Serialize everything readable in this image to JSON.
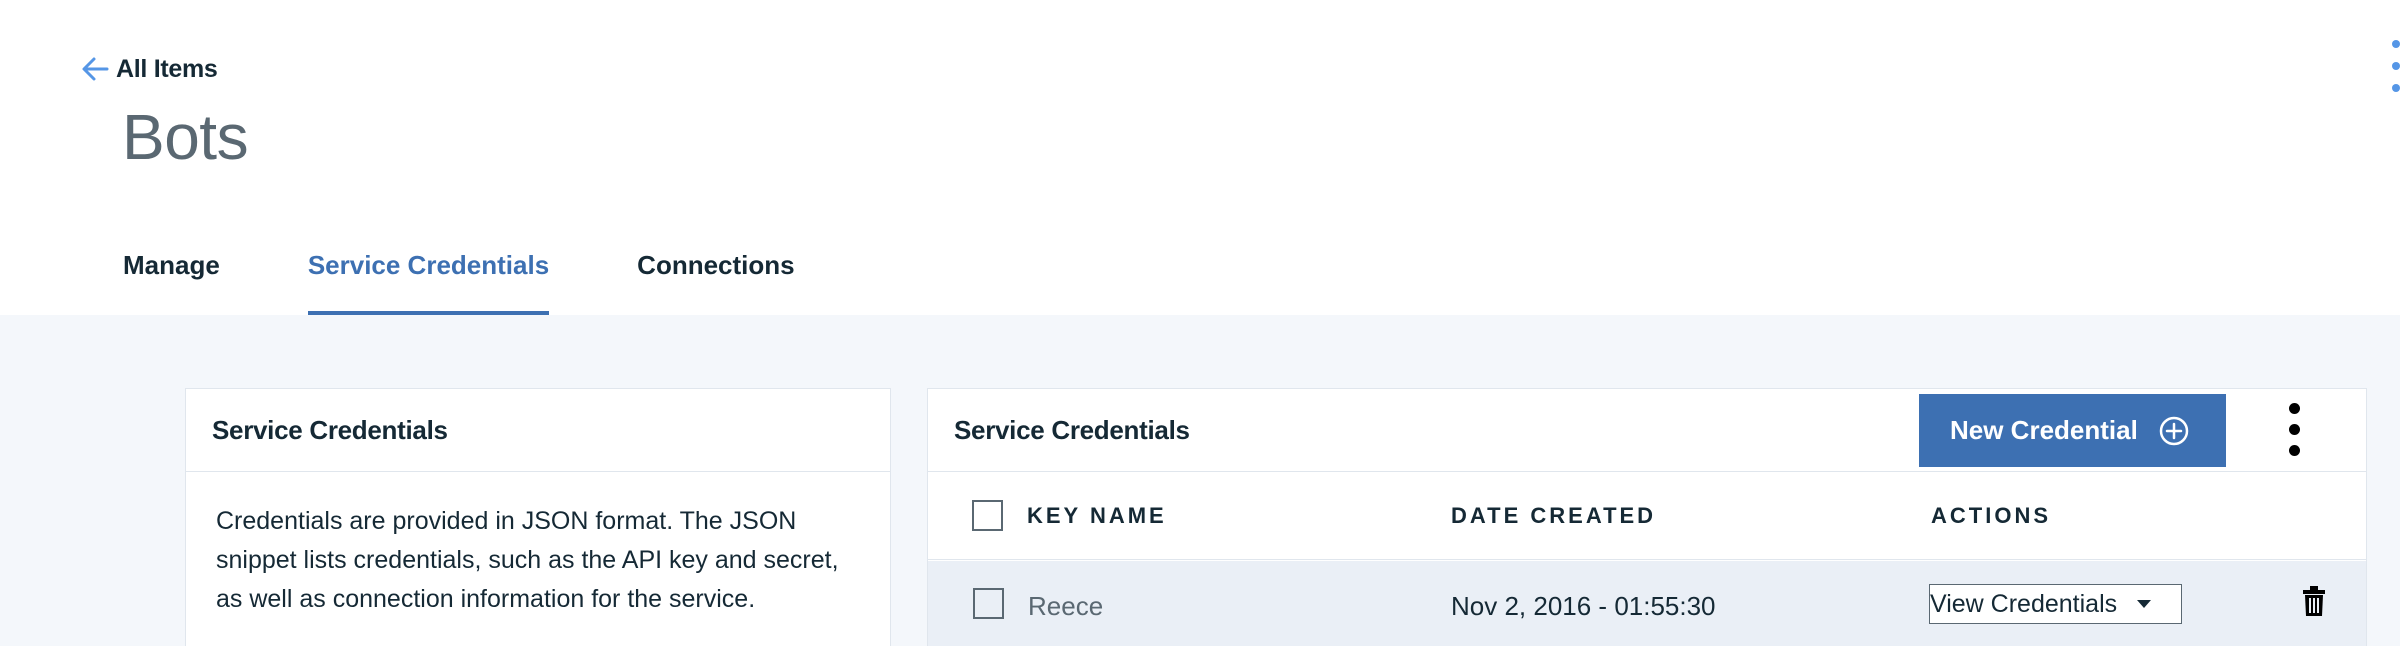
{
  "header": {
    "back_label": "All Items",
    "title": "Bots"
  },
  "tabs": [
    {
      "label": "Manage",
      "active": false
    },
    {
      "label": "Service Credentials",
      "active": true
    },
    {
      "label": "Connections",
      "active": false
    }
  ],
  "info_card": {
    "title": "Service Credentials",
    "description": "Credentials are provided in JSON format. The JSON snippet lists credentials, such as the API key and secret, as well as connection information for the service."
  },
  "credentials_card": {
    "title": "Service Credentials",
    "new_button_label": "New Credential",
    "columns": [
      "KEY NAME",
      "DATE CREATED",
      "ACTIONS"
    ],
    "rows": [
      {
        "key_name": "Reece",
        "date_created": "Nov 2, 2016 - 01:55:30",
        "action_selected": "View Credentials"
      }
    ]
  },
  "colors": {
    "accent": "#3d70b2",
    "page_bg": "#f4f7fb",
    "row_bg": "#eaeff6",
    "text": "#152935",
    "muted": "#5a6872"
  },
  "icons": [
    "arrow-left-icon",
    "plus-circle-icon",
    "overflow-menu-icon",
    "trash-icon",
    "chevron-down-icon"
  ]
}
